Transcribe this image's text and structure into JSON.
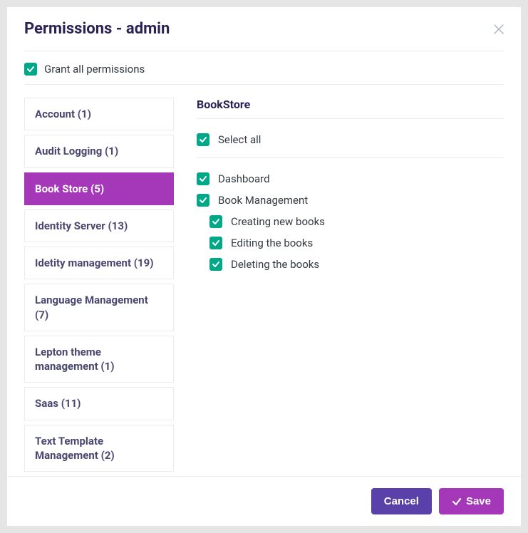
{
  "modal": {
    "title": "Permissions - admin",
    "grant_all_label": "Grant all permissions",
    "grant_all_checked": true
  },
  "sidebar": {
    "items": [
      {
        "label": "Account (1)",
        "active": false
      },
      {
        "label": "Audit Logging (1)",
        "active": false
      },
      {
        "label": "Book Store (5)",
        "active": true
      },
      {
        "label": "Identity Server (13)",
        "active": false
      },
      {
        "label": "Idetity management (19)",
        "active": false
      },
      {
        "label": "Language Management (7)",
        "active": false
      },
      {
        "label": "Lepton theme management (1)",
        "active": false
      },
      {
        "label": "Saas (11)",
        "active": false
      },
      {
        "label": "Text Template Management (2)",
        "active": false
      }
    ]
  },
  "main": {
    "section_title": "BookStore",
    "select_all_label": "Select all",
    "select_all_checked": true,
    "permissions": [
      {
        "label": "Dashboard",
        "checked": true,
        "indent": 0
      },
      {
        "label": "Book Management",
        "checked": true,
        "indent": 0
      },
      {
        "label": "Creating new books",
        "checked": true,
        "indent": 1
      },
      {
        "label": "Editing the books",
        "checked": true,
        "indent": 1
      },
      {
        "label": "Deleting the books",
        "checked": true,
        "indent": 1
      }
    ]
  },
  "footer": {
    "cancel_label": "Cancel",
    "save_label": "Save"
  },
  "colors": {
    "accent_purple": "#a438b8",
    "button_indigo": "#5941a9",
    "checkbox_green": "#00a887"
  }
}
